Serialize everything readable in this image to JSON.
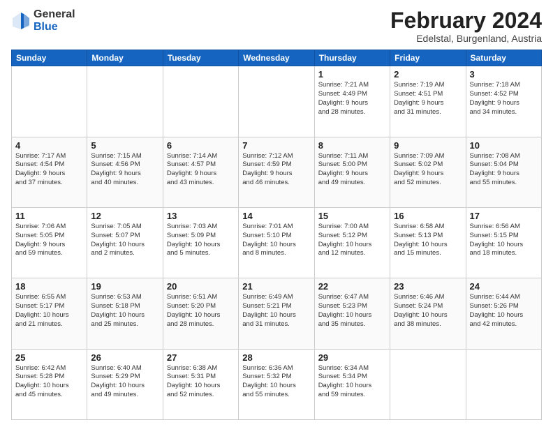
{
  "logo": {
    "general": "General",
    "blue": "Blue"
  },
  "header": {
    "title": "February 2024",
    "subtitle": "Edelstal, Burgenland, Austria"
  },
  "weekdays": [
    "Sunday",
    "Monday",
    "Tuesday",
    "Wednesday",
    "Thursday",
    "Friday",
    "Saturday"
  ],
  "weeks": [
    [
      {
        "day": "",
        "info": ""
      },
      {
        "day": "",
        "info": ""
      },
      {
        "day": "",
        "info": ""
      },
      {
        "day": "",
        "info": ""
      },
      {
        "day": "1",
        "info": "Sunrise: 7:21 AM\nSunset: 4:49 PM\nDaylight: 9 hours\nand 28 minutes."
      },
      {
        "day": "2",
        "info": "Sunrise: 7:19 AM\nSunset: 4:51 PM\nDaylight: 9 hours\nand 31 minutes."
      },
      {
        "day": "3",
        "info": "Sunrise: 7:18 AM\nSunset: 4:52 PM\nDaylight: 9 hours\nand 34 minutes."
      }
    ],
    [
      {
        "day": "4",
        "info": "Sunrise: 7:17 AM\nSunset: 4:54 PM\nDaylight: 9 hours\nand 37 minutes."
      },
      {
        "day": "5",
        "info": "Sunrise: 7:15 AM\nSunset: 4:56 PM\nDaylight: 9 hours\nand 40 minutes."
      },
      {
        "day": "6",
        "info": "Sunrise: 7:14 AM\nSunset: 4:57 PM\nDaylight: 9 hours\nand 43 minutes."
      },
      {
        "day": "7",
        "info": "Sunrise: 7:12 AM\nSunset: 4:59 PM\nDaylight: 9 hours\nand 46 minutes."
      },
      {
        "day": "8",
        "info": "Sunrise: 7:11 AM\nSunset: 5:00 PM\nDaylight: 9 hours\nand 49 minutes."
      },
      {
        "day": "9",
        "info": "Sunrise: 7:09 AM\nSunset: 5:02 PM\nDaylight: 9 hours\nand 52 minutes."
      },
      {
        "day": "10",
        "info": "Sunrise: 7:08 AM\nSunset: 5:04 PM\nDaylight: 9 hours\nand 55 minutes."
      }
    ],
    [
      {
        "day": "11",
        "info": "Sunrise: 7:06 AM\nSunset: 5:05 PM\nDaylight: 9 hours\nand 59 minutes."
      },
      {
        "day": "12",
        "info": "Sunrise: 7:05 AM\nSunset: 5:07 PM\nDaylight: 10 hours\nand 2 minutes."
      },
      {
        "day": "13",
        "info": "Sunrise: 7:03 AM\nSunset: 5:09 PM\nDaylight: 10 hours\nand 5 minutes."
      },
      {
        "day": "14",
        "info": "Sunrise: 7:01 AM\nSunset: 5:10 PM\nDaylight: 10 hours\nand 8 minutes."
      },
      {
        "day": "15",
        "info": "Sunrise: 7:00 AM\nSunset: 5:12 PM\nDaylight: 10 hours\nand 12 minutes."
      },
      {
        "day": "16",
        "info": "Sunrise: 6:58 AM\nSunset: 5:13 PM\nDaylight: 10 hours\nand 15 minutes."
      },
      {
        "day": "17",
        "info": "Sunrise: 6:56 AM\nSunset: 5:15 PM\nDaylight: 10 hours\nand 18 minutes."
      }
    ],
    [
      {
        "day": "18",
        "info": "Sunrise: 6:55 AM\nSunset: 5:17 PM\nDaylight: 10 hours\nand 21 minutes."
      },
      {
        "day": "19",
        "info": "Sunrise: 6:53 AM\nSunset: 5:18 PM\nDaylight: 10 hours\nand 25 minutes."
      },
      {
        "day": "20",
        "info": "Sunrise: 6:51 AM\nSunset: 5:20 PM\nDaylight: 10 hours\nand 28 minutes."
      },
      {
        "day": "21",
        "info": "Sunrise: 6:49 AM\nSunset: 5:21 PM\nDaylight: 10 hours\nand 31 minutes."
      },
      {
        "day": "22",
        "info": "Sunrise: 6:47 AM\nSunset: 5:23 PM\nDaylight: 10 hours\nand 35 minutes."
      },
      {
        "day": "23",
        "info": "Sunrise: 6:46 AM\nSunset: 5:24 PM\nDaylight: 10 hours\nand 38 minutes."
      },
      {
        "day": "24",
        "info": "Sunrise: 6:44 AM\nSunset: 5:26 PM\nDaylight: 10 hours\nand 42 minutes."
      }
    ],
    [
      {
        "day": "25",
        "info": "Sunrise: 6:42 AM\nSunset: 5:28 PM\nDaylight: 10 hours\nand 45 minutes."
      },
      {
        "day": "26",
        "info": "Sunrise: 6:40 AM\nSunset: 5:29 PM\nDaylight: 10 hours\nand 49 minutes."
      },
      {
        "day": "27",
        "info": "Sunrise: 6:38 AM\nSunset: 5:31 PM\nDaylight: 10 hours\nand 52 minutes."
      },
      {
        "day": "28",
        "info": "Sunrise: 6:36 AM\nSunset: 5:32 PM\nDaylight: 10 hours\nand 55 minutes."
      },
      {
        "day": "29",
        "info": "Sunrise: 6:34 AM\nSunset: 5:34 PM\nDaylight: 10 hours\nand 59 minutes."
      },
      {
        "day": "",
        "info": ""
      },
      {
        "day": "",
        "info": ""
      }
    ]
  ]
}
